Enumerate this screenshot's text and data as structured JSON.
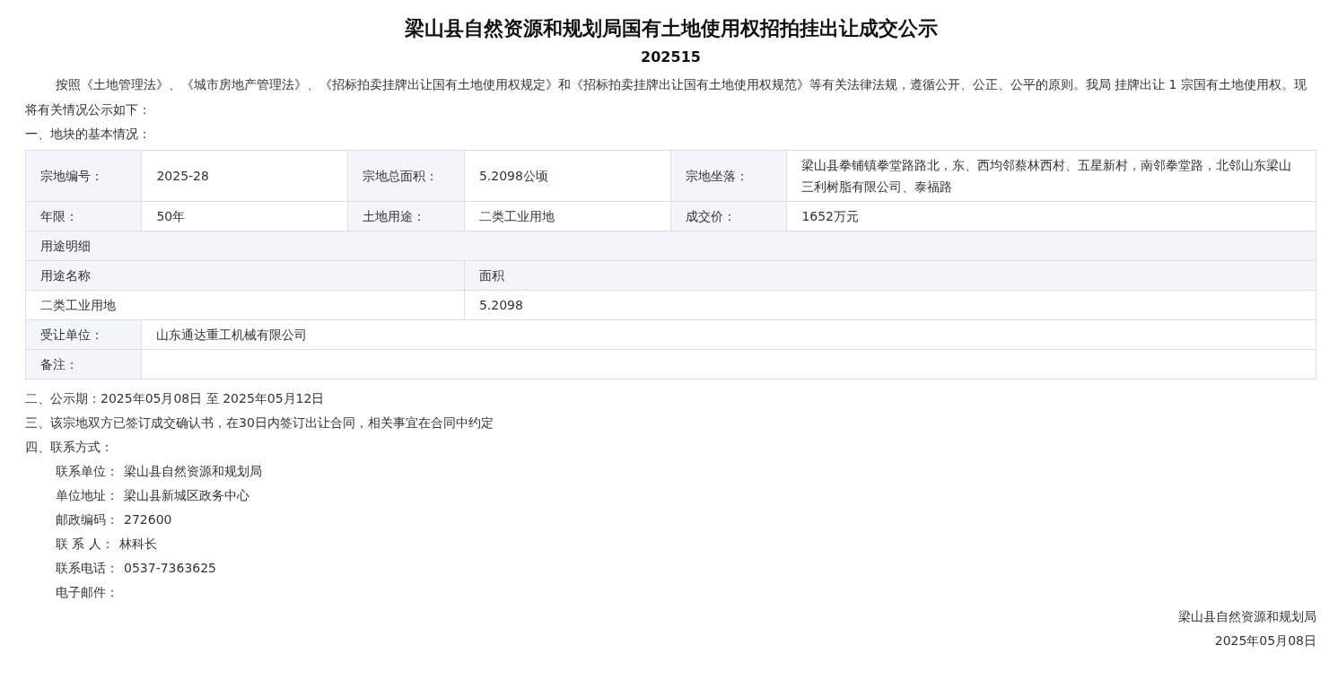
{
  "title": "梁山县自然资源和规划局国有土地使用权招拍挂出让成交公示",
  "number": "202515",
  "intro": "按照《土地管理法》、《城市房地产管理法》、《招标拍卖挂牌出让国有土地使用权规定》和《招标拍卖挂牌出让国有土地使用权规范》等有关法律法规，遵循公开、公正、公平的原则。我局 挂牌出让 1 宗国有土地使用权。现将有关情况公示如下：",
  "section_1": "一、地块的基本情况：",
  "table": {
    "rows": [
      {
        "kind": "pairs",
        "cells": [
          {
            "label": "宗地编号：",
            "value": "2025-28"
          },
          {
            "label": "宗地总面积：",
            "value": "5.2098公顷"
          },
          {
            "label": "宗地坐落：",
            "value": "梁山县拳铺镇拳堂路路北，东、西均邻蔡林西村、五星新村，南邻拳堂路，北邻山东梁山三利树脂有限公司、泰福路"
          }
        ]
      },
      {
        "kind": "pairs",
        "cells": [
          {
            "label": "年限：",
            "value": "50年"
          },
          {
            "label": "土地用途：",
            "value": "二类工业用地"
          },
          {
            "label": "成交价：",
            "value": "1652万元"
          }
        ]
      },
      {
        "kind": "section",
        "label": "用途明细"
      },
      {
        "kind": "detail_header",
        "cells": [
          "用途名称",
          "面积"
        ]
      },
      {
        "kind": "detail",
        "cells": [
          "二类工业用地",
          "5.2098"
        ]
      },
      {
        "kind": "wide",
        "label": "受让单位：",
        "value": "山东通达重工机械有限公司"
      },
      {
        "kind": "wide",
        "label": "备注："
      }
    ]
  },
  "sections": [
    "二、公示期：2025年05月08日 至 2025年05月12日",
    "三、该宗地双方已签订成交确认书，在30日内签订出让合同，相关事宜在合同中约定",
    "四、联系方式："
  ],
  "contacts": [
    {
      "label": "联系单位：",
      "value": "梁山县自然资源和规划局"
    },
    {
      "label": "单位地址：",
      "value": "梁山县新城区政务中心"
    },
    {
      "label": "邮政编码：",
      "value": "272600"
    },
    {
      "label": "联 系 人：",
      "value": "林科长"
    },
    {
      "label": "联系电话：",
      "value": "0537-7363625"
    },
    {
      "label": "电子邮件："
    }
  ],
  "footer": {
    "organization": "梁山县自然资源和规划局",
    "date": "2025年05月08日"
  }
}
